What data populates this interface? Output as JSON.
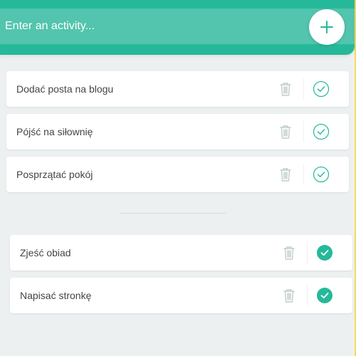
{
  "header": {
    "input_placeholder": "Enter an activity...",
    "add_button_icon": "plus-icon"
  },
  "todo": [
    {
      "label": "Dodać posta na blogu",
      "completed": false
    },
    {
      "label": "Pójść na siłownię",
      "completed": false
    },
    {
      "label": "Posprzątać pokój",
      "completed": false
    }
  ],
  "completed": [
    {
      "label": "Zjeść obiad",
      "completed": true
    },
    {
      "label": "Napisać stronkę",
      "completed": true
    }
  ],
  "icons": {
    "delete": "trash-icon",
    "complete": "check-circle-icon"
  },
  "colors": {
    "accent": "#25b99a",
    "input_bg": "#53c4ad",
    "background": "#edf0f1",
    "trash": "#c0cecb",
    "right_edge": "#f2dc5d"
  }
}
